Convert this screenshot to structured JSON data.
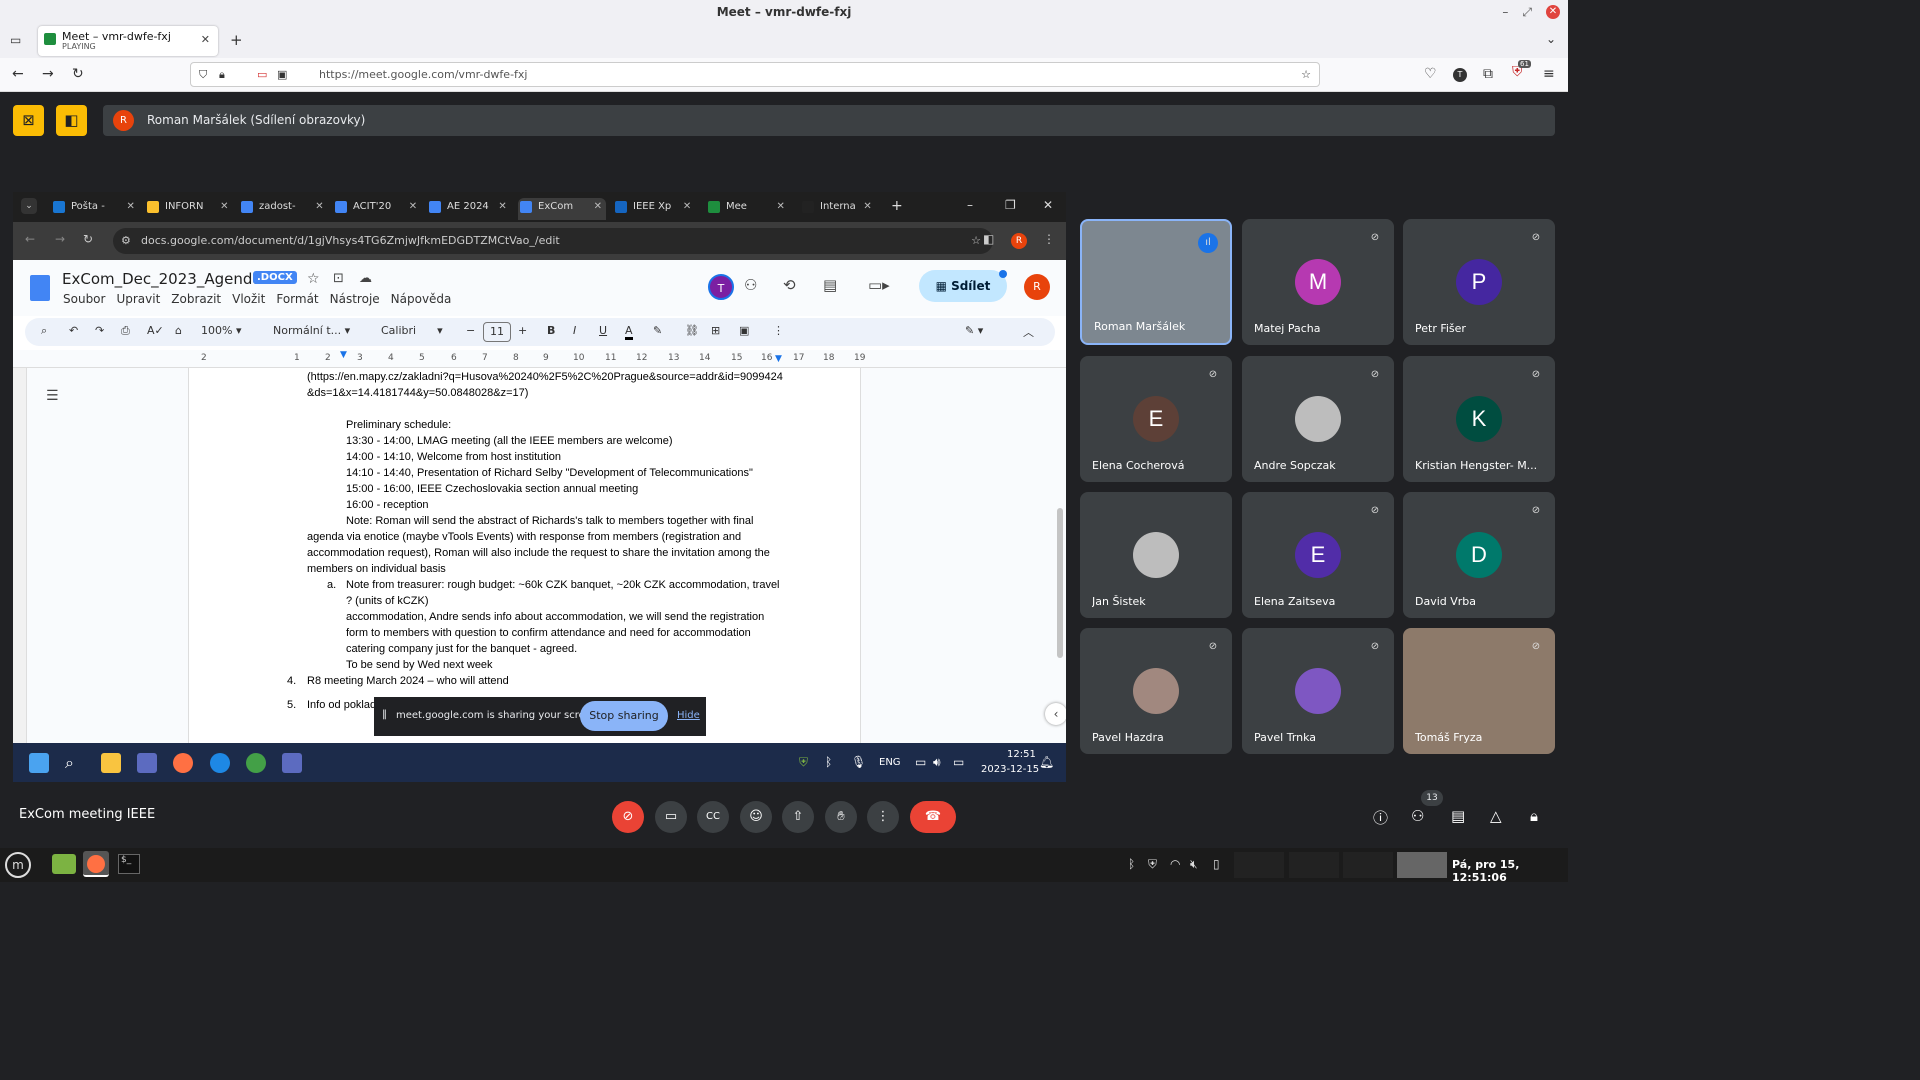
{
  "firefox": {
    "window_title": "Meet – vmr-dwfe-fxj",
    "tab_title": "Meet – vmr-dwfe-fxj",
    "tab_status": "PLAYING",
    "url": "https://meet.google.com/vmr-dwfe-fxj",
    "notif_count": "61"
  },
  "meet": {
    "presenter": "Roman Maršálek (Sdílení obrazovky)",
    "presenter_initial": "R",
    "meeting_name": "ExCom meeting IEEE",
    "participants_count": "13"
  },
  "chrome": {
    "tabs": [
      "Pošta -",
      "INFORN",
      "zadost-",
      "ACIT'20",
      "AE 2024",
      "ExCom",
      "IEEE Xp",
      "Mee",
      "Interna"
    ],
    "url": "docs.google.com/document/d/1gjVhsys4TG6ZmjwJfkmEDGDTZMCtVao_/edit"
  },
  "docs": {
    "title": "ExCom_Dec_2023_Agenda",
    "badge": ".DOCX",
    "share": "Sdílet",
    "avatar_t": "T",
    "avatar_r": "R",
    "menu": [
      "Soubor",
      "Upravit",
      "Zobrazit",
      "Vložit",
      "Formát",
      "Nástroje",
      "Nápověda"
    ],
    "zoom": "100%",
    "style": "Normální t...",
    "font": "Calibri",
    "font_size": "11",
    "ruler": [
      "2",
      "1",
      "1",
      "2",
      "3",
      "4",
      "5",
      "6",
      "7",
      "8",
      "9",
      "10",
      "11",
      "12",
      "13",
      "14",
      "15",
      "16",
      "17",
      "18",
      "19"
    ],
    "lines": [
      "(https://en.mapy.cz/zakladni?q=Husova%20240%2F5%2C%20Prague&source=addr&id=9099424",
      "&ds=1&x=14.4181744&y=50.0848028&z=17)",
      "Preliminary schedule:",
      "13:30 - 14:00,   LMAG meeting (all the IEEE members are welcome)",
      "14:00 - 14:10,   Welcome from host institution",
      "14:10 - 14:40,   Presentation of Richard Selby \"Development of Telecommunications\"",
      "15:00 - 16:00,   IEEE Czechoslovakia section annual meeting",
      "16:00 -               reception",
      "Note: Roman will send the abstract of Richards's talk to members together with final",
      "agenda via enotice (maybe vTools Events) with response from members (registration and",
      "accommodation request), Roman will also include the request to share the invitation among the",
      "members on individual basis",
      "Note from treasurer: rough budget: ~60k CZK banquet, ~20k CZK accommodation, travel",
      "? (units of kCZK)",
      "accommodation, Andre sends info about accommodation, we will send the registration",
      "form to members with question to confirm attendance and need for accommodation",
      "catering company just for the banquet - agreed.",
      "To be send by Wed next week",
      "R8 meeting March 2024 – who will attend",
      "Info od poklad"
    ],
    "list_marks": {
      "a": "a.",
      "four": "4.",
      "five": "5."
    }
  },
  "notification": {
    "text": "meet.google.com is sharing your screen.",
    "stop": "Stop sharing",
    "hide": "Hide"
  },
  "win_taskbar": {
    "time": "12:51",
    "date": "2023-12-15",
    "lang": "ENG"
  },
  "participants": [
    {
      "name": "Roman Maršálek",
      "initial": "",
      "color": "#6d7b8a"
    },
    {
      "name": "Matej Pacha",
      "initial": "M",
      "color": "#b639b1"
    },
    {
      "name": "Petr Fišer",
      "initial": "P",
      "color": "#4527a0"
    },
    {
      "name": "Elena Cocherová",
      "initial": "E",
      "color": "#5d4037"
    },
    {
      "name": "Andre Sopczak",
      "initial": "",
      "color": "#9e9e9e"
    },
    {
      "name": "Kristian Hengster- M...",
      "initial": "K",
      "color": "#004d40"
    },
    {
      "name": "Jan Šistek",
      "initial": "",
      "color": "#9e9e9e"
    },
    {
      "name": "Elena Zaitseva",
      "initial": "E",
      "color": "#512da8"
    },
    {
      "name": "David Vrba",
      "initial": "D",
      "color": "#00796b"
    },
    {
      "name": "Pavel Hazdra",
      "initial": "",
      "color": "#a1887f"
    },
    {
      "name": "Pavel Trnka",
      "initial": "",
      "color": "#7e57c2"
    },
    {
      "name": "Tomáš Fryza",
      "initial": "",
      "color": "#8d7a6a"
    }
  ],
  "os": {
    "clock": "Pá, pro 15, 12:51:06"
  }
}
